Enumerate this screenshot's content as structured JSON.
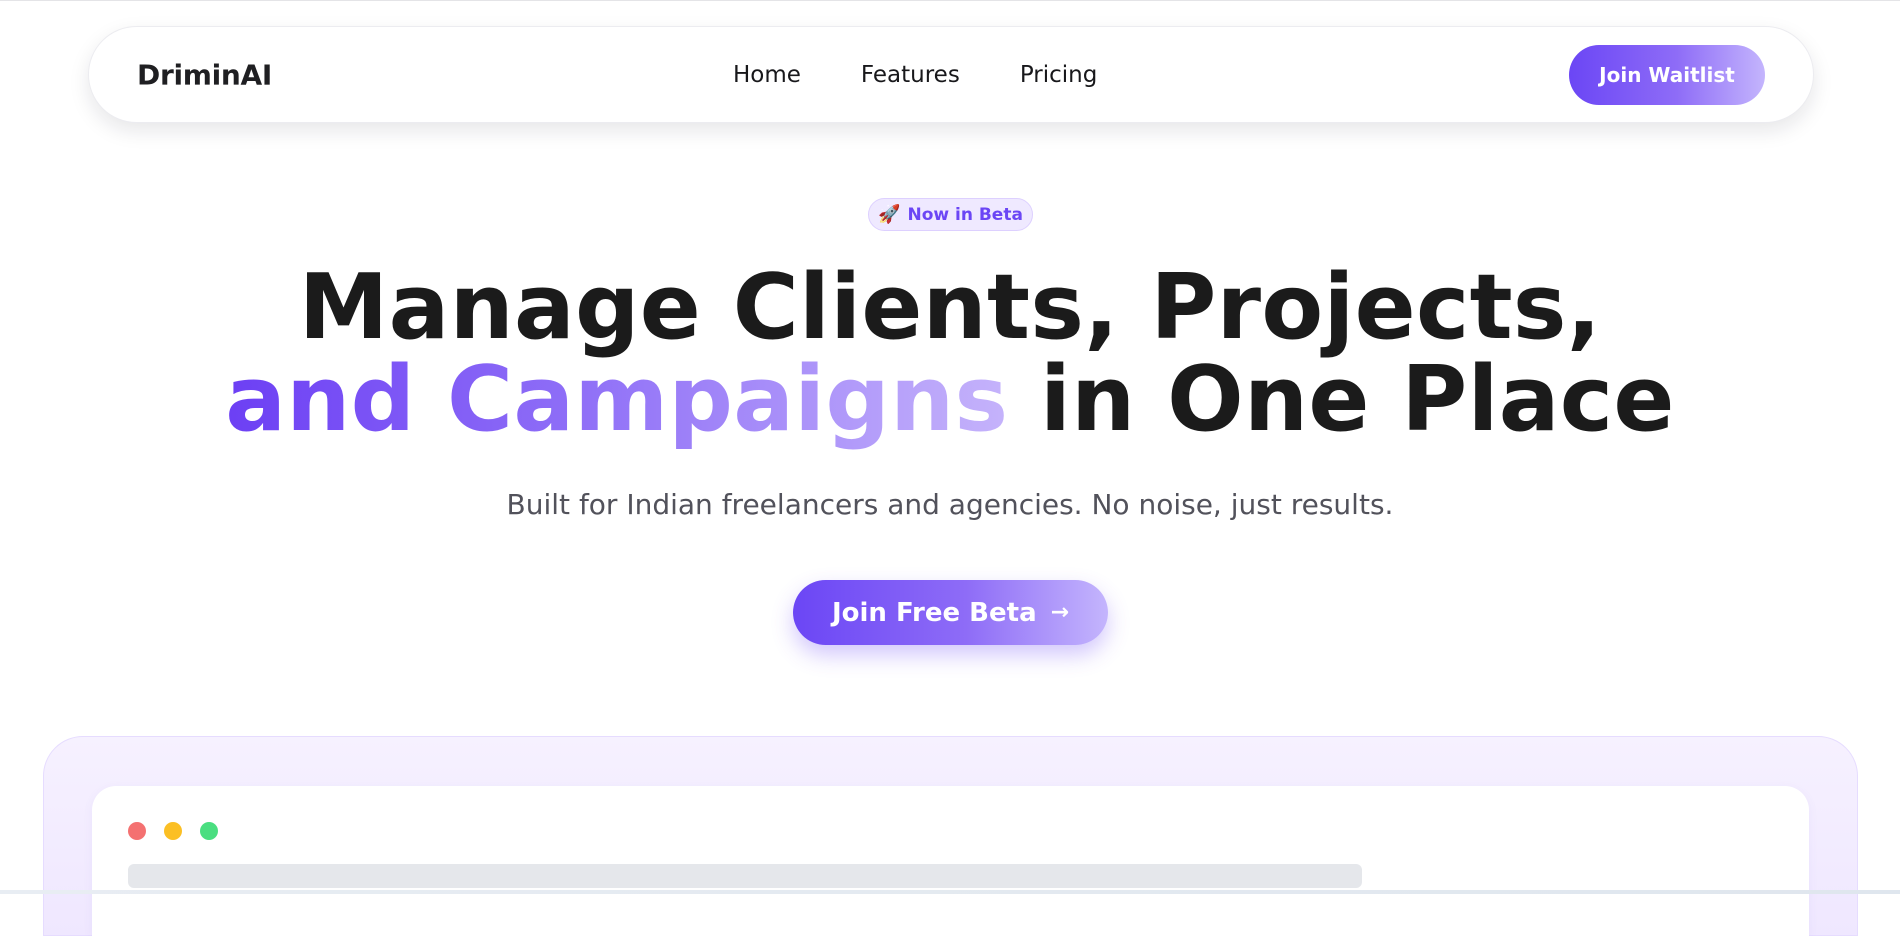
{
  "brand": {
    "name": "DriminAI"
  },
  "nav": {
    "links": [
      "Home",
      "Features",
      "Pricing"
    ],
    "cta_label": "Join Waitlist"
  },
  "hero": {
    "badge_icon": "rocket-icon",
    "badge_emoji": "🚀",
    "badge_label": "Now in Beta",
    "headline_line1": "Manage Clients, Projects,",
    "headline_line2_highlight": "and Campaigns",
    "headline_line2_rest": " in One Place",
    "subtitle": "Built for Indian freelancers and agencies. No noise, just results.",
    "cta_label": "Join Free Beta",
    "cta_icon": "arrow-right-icon",
    "cta_arrow": "→"
  },
  "preview": {
    "window_controls": [
      "close",
      "minimize",
      "maximize"
    ]
  },
  "colors": {
    "accent": "#6b46f5",
    "accent_light": "#c4b5fd",
    "text_dark": "#1b1b1b",
    "text_muted": "#52525b",
    "badge_bg": "#efe9ff"
  }
}
